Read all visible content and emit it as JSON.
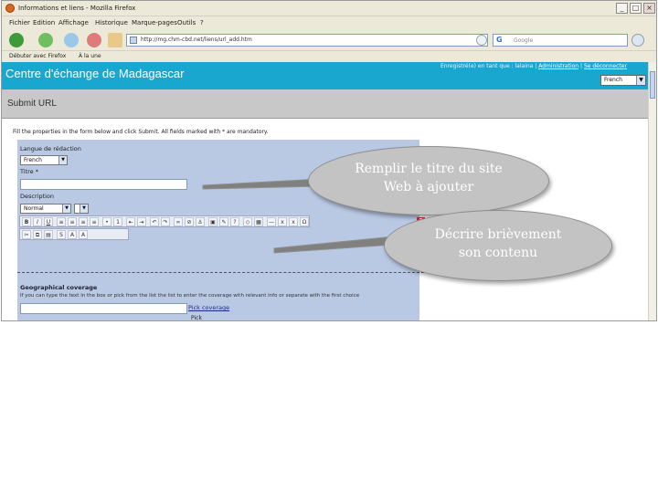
{
  "window": {
    "title": "Informations et liens - Mozilla Firefox",
    "minimize": "_",
    "maximize": "□",
    "close": "×"
  },
  "menu": [
    "Fichier",
    "Edition",
    "Affichage",
    "Historique",
    "Marque-pages",
    "Outils",
    "?"
  ],
  "nav": {
    "url": "http://mg.chm-cbd.net/liens/url_add.htm",
    "search_placeholder": "Google",
    "search_engine": "G"
  },
  "bookmarks": [
    "Débuter avec Firefox",
    "À la une"
  ],
  "site": {
    "title": "Centre d'échange de Madagascar",
    "user_text": "Enregistré(e) en tant que : lalaina | ",
    "admin_link": "Administration",
    "separator": " | ",
    "logout_link": "Se déconnecter",
    "language": "French",
    "page_heading": "Submit URL",
    "header_color": "#1aa7cf"
  },
  "form": {
    "instruction": "Fill the properties in the form below and click Submit. All fields marked with * are mandatory.",
    "language_label": "Langue de rédaction",
    "language_value": "French",
    "title_label": "Titre *",
    "title_value": "",
    "description_label": "Description",
    "format_value": "Normal",
    "geo_label": "Geographical coverage",
    "geo_help": "If you can type the text in the box or pick from the list the list to enter the coverage with relevant info or separate with the first choice",
    "pick_coverage_link": "Pick coverage",
    "pick_button": "Pick"
  },
  "callouts": {
    "title_callout": [
      "Remplir le titre du site",
      "Web à ajouter"
    ],
    "description_callout": [
      "Décrire brièvement",
      "son contenu"
    ]
  }
}
